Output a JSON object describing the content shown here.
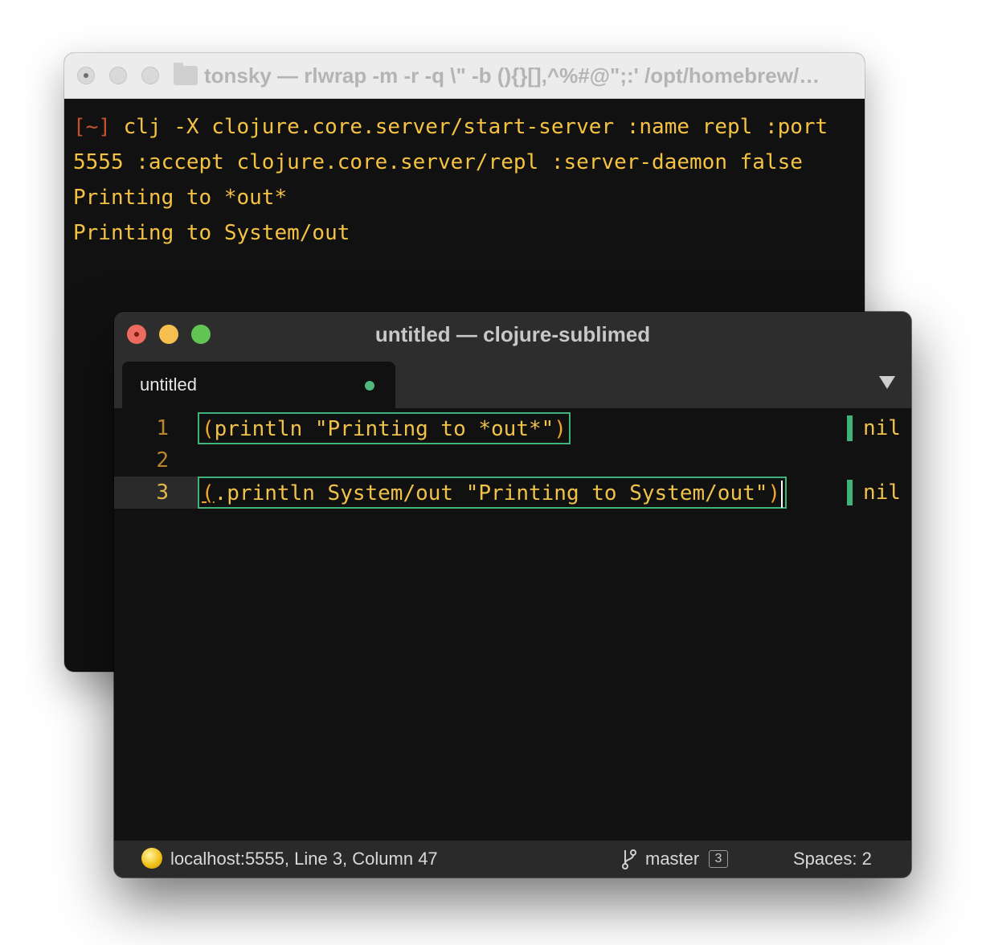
{
  "terminal": {
    "title": "tonsky — rlwrap -m -r -q \\\" -b (){}[],^%#@\";:' /opt/homebrew/…",
    "lines": [
      {
        "prompt": "[~]",
        "text": " clj -X clojure.core.server/start-server :name repl :port"
      },
      {
        "prompt": "",
        "text": "5555 :accept clojure.core.server/repl :server-daemon false"
      },
      {
        "prompt": "",
        "text": "Printing to *out*"
      },
      {
        "prompt": "",
        "text": "Printing to System/out"
      }
    ]
  },
  "editor": {
    "title": "untitled — clojure-sublimed",
    "tab": {
      "label": "untitled"
    },
    "lines": [
      {
        "number": "1",
        "open": "(",
        "body": "println \"Printing to *out*\"",
        "close": ")",
        "result": "nil"
      },
      {
        "number": "2"
      },
      {
        "number": "3",
        "open": "(",
        "body": ".println System/out \"Printing to System/out\"",
        "close": ")",
        "result": "nil"
      }
    ],
    "status": {
      "connection": "localhost:5555, Line 3, Column 47",
      "branch": "master",
      "branch_count": "3",
      "spaces": "Spaces: 2"
    }
  },
  "colors": {
    "terminal_text": "#f5c242",
    "prompt": "#c4502c",
    "eval_border": "#3fb37a",
    "modified_dot": "#4fb87a"
  },
  "icons": {
    "status_ball": "ball-icon",
    "branch": "git-branch-icon",
    "tab_menu": "chevron-down-icon"
  }
}
